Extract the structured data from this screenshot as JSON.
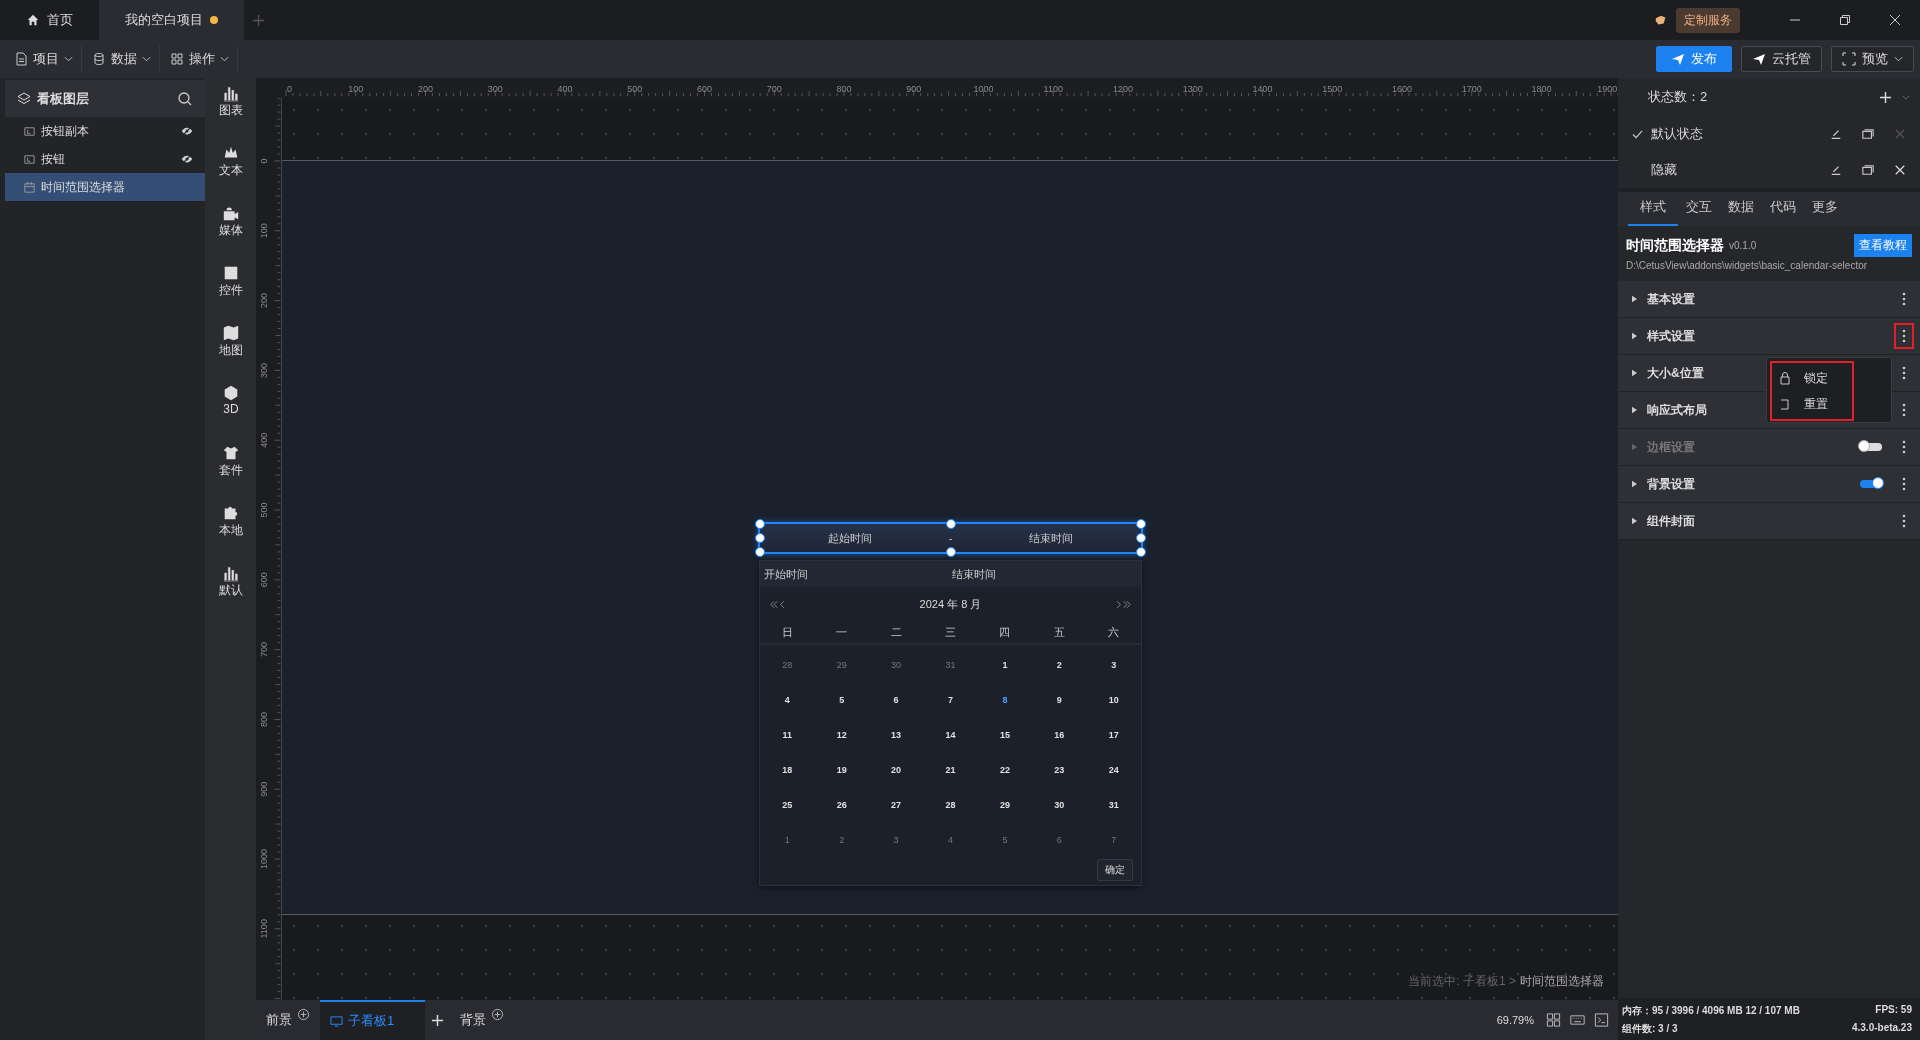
{
  "title_tabs": [
    {
      "label": "首页",
      "kind": "home",
      "selected": false,
      "unsaved": false
    },
    {
      "label": "我的空白项目",
      "kind": "project",
      "selected": true,
      "unsaved": true
    }
  ],
  "custom_service": "定制服务",
  "menus": [
    {
      "label": "项目",
      "kind": "file"
    },
    {
      "label": "数据",
      "kind": "data"
    },
    {
      "label": "操作",
      "kind": "grid"
    }
  ],
  "actions": [
    {
      "label": "发布",
      "kind": "primary"
    },
    {
      "label": "云托管",
      "kind": "cloud"
    },
    {
      "label": "预览",
      "kind": "preview"
    }
  ],
  "layers": {
    "title": "看板图层",
    "items": [
      {
        "label": "按钮副本",
        "kind": "button",
        "hidden": true,
        "selected": false
      },
      {
        "label": "按钮",
        "kind": "button",
        "hidden": true,
        "selected": false
      },
      {
        "label": "时间范围选择器",
        "kind": "calendar",
        "hidden": false,
        "selected": true
      }
    ]
  },
  "components": [
    {
      "label": "图表",
      "kind": "chart"
    },
    {
      "label": "文本",
      "kind": "text"
    },
    {
      "label": "媒体",
      "kind": "media"
    },
    {
      "label": "控件",
      "kind": "control"
    },
    {
      "label": "地图",
      "kind": "map"
    },
    {
      "label": "3D",
      "kind": "cube"
    },
    {
      "label": "套件",
      "kind": "suit"
    },
    {
      "label": "本地",
      "kind": "puzzle"
    },
    {
      "label": "默认",
      "kind": "chart"
    }
  ],
  "ruler": {
    "x_labels": [
      "0",
      "100",
      "200",
      "300",
      "400",
      "500",
      "600",
      "700",
      "800",
      "900",
      "1000",
      "1100",
      "1200",
      "1300",
      "1400",
      "1500",
      "1600",
      "1700",
      "1800",
      "1900"
    ],
    "y_labels": [
      "0",
      "100",
      "200",
      "300",
      "400",
      "500",
      "600",
      "700",
      "800",
      "900",
      "1000",
      "1100"
    ]
  },
  "widget": {
    "start_placeholder": "起始时间",
    "separator": "-",
    "end_placeholder": "结束时间",
    "panel": {
      "start_label": "开始时间",
      "end_label": "结束时间",
      "month": "2024 年 8 月",
      "weekdays": [
        "日",
        "一",
        "二",
        "三",
        "四",
        "五",
        "六"
      ],
      "days": [
        {
          "text": "28",
          "kind": "other",
          "today": false
        },
        {
          "text": "29",
          "kind": "other",
          "today": false
        },
        {
          "text": "30",
          "kind": "other",
          "today": false
        },
        {
          "text": "31",
          "kind": "other",
          "today": false
        },
        {
          "text": "1",
          "kind": "current",
          "today": false
        },
        {
          "text": "2",
          "kind": "current",
          "today": false
        },
        {
          "text": "3",
          "kind": "current",
          "today": false
        },
        {
          "text": "4",
          "kind": "current",
          "today": false
        },
        {
          "text": "5",
          "kind": "current",
          "today": false
        },
        {
          "text": "6",
          "kind": "current",
          "today": false
        },
        {
          "text": "7",
          "kind": "current",
          "today": false
        },
        {
          "text": "8",
          "kind": "current",
          "today": true
        },
        {
          "text": "9",
          "kind": "current",
          "today": false
        },
        {
          "text": "10",
          "kind": "current",
          "today": false
        },
        {
          "text": "11",
          "kind": "current",
          "today": false
        },
        {
          "text": "12",
          "kind": "current",
          "today": false
        },
        {
          "text": "13",
          "kind": "current",
          "today": false
        },
        {
          "text": "14",
          "kind": "current",
          "today": false
        },
        {
          "text": "15",
          "kind": "current",
          "today": false
        },
        {
          "text": "16",
          "kind": "current",
          "today": false
        },
        {
          "text": "17",
          "kind": "current",
          "today": false
        },
        {
          "text": "18",
          "kind": "current",
          "today": false
        },
        {
          "text": "19",
          "kind": "current",
          "today": false
        },
        {
          "text": "20",
          "kind": "current",
          "today": false
        },
        {
          "text": "21",
          "kind": "current",
          "today": false
        },
        {
          "text": "22",
          "kind": "current",
          "today": false
        },
        {
          "text": "23",
          "kind": "current",
          "today": false
        },
        {
          "text": "24",
          "kind": "current",
          "today": false
        },
        {
          "text": "25",
          "kind": "current",
          "today": false
        },
        {
          "text": "26",
          "kind": "current",
          "today": false
        },
        {
          "text": "27",
          "kind": "current",
          "today": false
        },
        {
          "text": "28",
          "kind": "current",
          "today": false
        },
        {
          "text": "29",
          "kind": "current",
          "today": false
        },
        {
          "text": "30",
          "kind": "current",
          "today": false
        },
        {
          "text": "31",
          "kind": "current",
          "today": false
        },
        {
          "text": "1",
          "kind": "other",
          "today": false
        },
        {
          "text": "2",
          "kind": "other",
          "today": false
        },
        {
          "text": "3",
          "kind": "other",
          "today": false
        },
        {
          "text": "4",
          "kind": "other",
          "today": false
        },
        {
          "text": "5",
          "kind": "other",
          "today": false
        },
        {
          "text": "6",
          "kind": "other",
          "today": false
        },
        {
          "text": "7",
          "kind": "other",
          "today": false
        }
      ],
      "confirm": "确定"
    }
  },
  "breadcrumb": {
    "prefix": "当前选中: 子看板1 >",
    "current": "时间范围选择器"
  },
  "bottom_tabs": [
    {
      "label": "前景",
      "selected": false,
      "kind": "layer"
    },
    {
      "label": "子看板1",
      "selected": true,
      "kind": "board"
    },
    {
      "label": "背景",
      "selected": false,
      "kind": "layer"
    }
  ],
  "zoom": "69.79%",
  "inspector": {
    "state_count": "状态数：2",
    "states": [
      {
        "label": "默认状态",
        "selected": true
      },
      {
        "label": "隐藏",
        "selected": false
      }
    ],
    "tabs": [
      {
        "label": "样式",
        "selected": true
      },
      {
        "label": "交互",
        "selected": false
      },
      {
        "label": "数据",
        "selected": false
      },
      {
        "label": "代码",
        "selected": false
      },
      {
        "label": "更多",
        "selected": false
      }
    ],
    "widget_name": "时间范围选择器",
    "version": "v0.1.0",
    "tutorial": "查看教程",
    "path": "D:\\CetusView\\addons\\widgets\\basic_calendar-selector",
    "sections": [
      {
        "label": "基本设置",
        "disabled": false,
        "highlighted": false
      },
      {
        "label": "样式设置",
        "disabled": false,
        "highlighted": true
      },
      {
        "label": "大小&位置",
        "disabled": false,
        "highlighted": false
      },
      {
        "label": "响应式布局",
        "disabled": false,
        "highlighted": false
      },
      {
        "label": "边框设置",
        "disabled": true,
        "highlighted": false,
        "kind": "toggle",
        "on": false
      },
      {
        "label": "背景设置",
        "disabled": false,
        "highlighted": false,
        "kind": "toggle",
        "on": true
      },
      {
        "label": "组件封面",
        "disabled": false,
        "highlighted": false
      }
    ],
    "menu": {
      "highlighted": true,
      "items": [
        {
          "label": "锁定",
          "kind": "lock"
        },
        {
          "label": "重置",
          "kind": "reset"
        }
      ]
    }
  },
  "status": {
    "memory": "内存：95 / 3996 / 4096 MB 12 / 107 MB",
    "fps": "FPS:  59",
    "components": "组件数: 3 / 3",
    "version": "4.3.0-beta.23"
  }
}
